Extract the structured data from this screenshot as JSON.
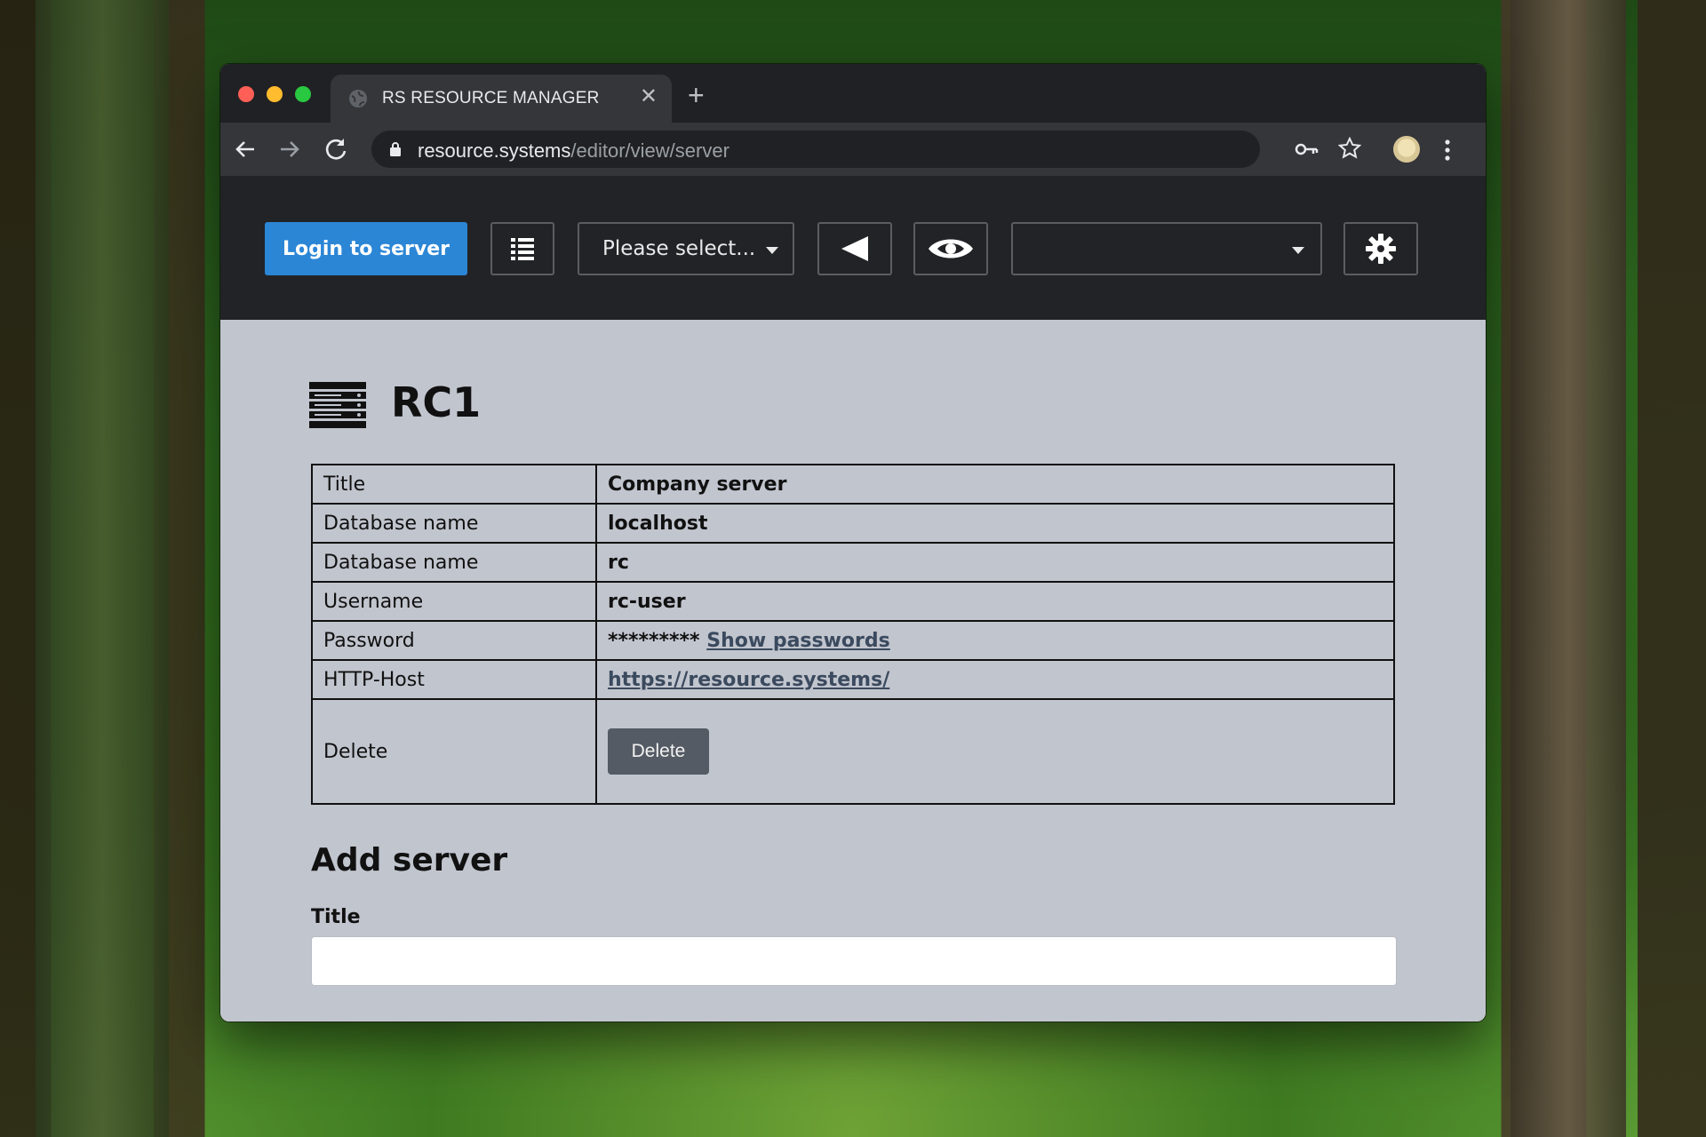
{
  "browser": {
    "tab_title": "RS RESOURCE MANAGER",
    "tab_close": "✕",
    "new_tab": "+",
    "url_host": "resource.systems",
    "url_path": "/editor/view/server"
  },
  "toolbar": {
    "login_label": "Login to server",
    "select_placeholder": "Please select...",
    "second_select_value": "",
    "accent_color": "#2c86d6"
  },
  "icons": {
    "toolbar": [
      "list-icon",
      "chevron-down-icon",
      "back-triangle-icon",
      "eye-icon",
      "gear-icon"
    ],
    "browser": [
      "back-arrow-icon",
      "forward-arrow-icon",
      "reload-icon",
      "lock-icon",
      "key-icon",
      "star-icon",
      "avatar",
      "menu-icon"
    ]
  },
  "page": {
    "title": "RC1",
    "rows": [
      {
        "label": "Title",
        "value": "Company server"
      },
      {
        "label": "Database name",
        "value": "localhost"
      },
      {
        "label": "Database name",
        "value": "rc"
      },
      {
        "label": "Username",
        "value": "rc-user"
      },
      {
        "label": "Password",
        "value": "*********",
        "link": "Show passwords"
      },
      {
        "label": "HTTP-Host",
        "link": "https://resource.systems/"
      },
      {
        "label": "Delete",
        "button": "Delete"
      }
    ]
  },
  "add_server": {
    "heading": "Add server",
    "title_label": "Title",
    "title_value": ""
  }
}
